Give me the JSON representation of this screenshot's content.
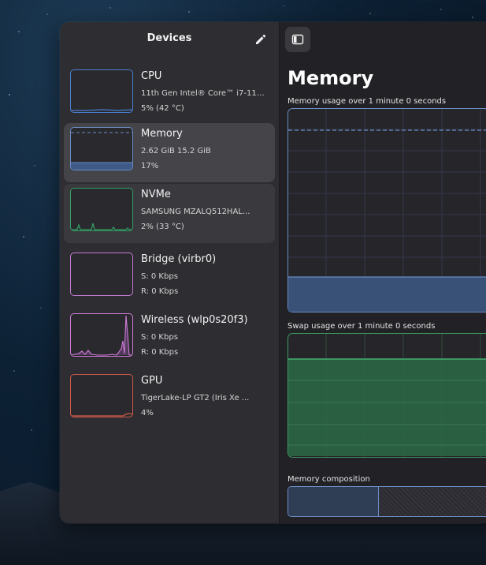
{
  "colors": {
    "cpu": "#4a7fd0",
    "memory": "#6a8cc4",
    "nvme": "#34a065",
    "bridge": "#c27ad2",
    "wireless": "#d07ad8",
    "gpu": "#d05a4a"
  },
  "sidebar": {
    "title": "Devices",
    "edit_icon": "pencil-icon",
    "devices": [
      {
        "name": "CPU",
        "line1": "11th Gen Intel® Core™ i7-116...",
        "line2": "5% (42 °C)",
        "usage_fraction": 0.05
      },
      {
        "name": "Memory",
        "line1": "2.62 GiB 15.2 GiB",
        "line2": "17%",
        "usage_fraction": 0.17
      },
      {
        "name": "NVMe",
        "line1": "SAMSUNG MZALQ512HAL...",
        "line2": "2% (33 °C)",
        "usage_fraction": 0.02
      },
      {
        "name": "Bridge (virbr0)",
        "line1": "S: 0 Kbps",
        "line2": "R: 0 Kbps"
      },
      {
        "name": "Wireless (wlp0s20f3)",
        "line1": "S: 0 Kbps",
        "line2": "R: 0 Kbps"
      },
      {
        "name": "GPU",
        "line1": "TigerLake-LP GT2 (Iris Xe ...",
        "line2": "4%",
        "usage_fraction": 0.04
      }
    ]
  },
  "main": {
    "toggle_icon": "sidebar-toggle-icon",
    "title": "Memory",
    "memory_graph": {
      "label": "Memory usage over 1 minute 0 seconds",
      "usage_fraction": 0.17,
      "dashed_level_fraction": 0.9
    },
    "swap_graph": {
      "label": "Swap usage over 1 minute 0 seconds",
      "usage_fraction": 0.8
    },
    "composition": {
      "label": "Memory composition",
      "used_fraction": 0.17
    }
  }
}
